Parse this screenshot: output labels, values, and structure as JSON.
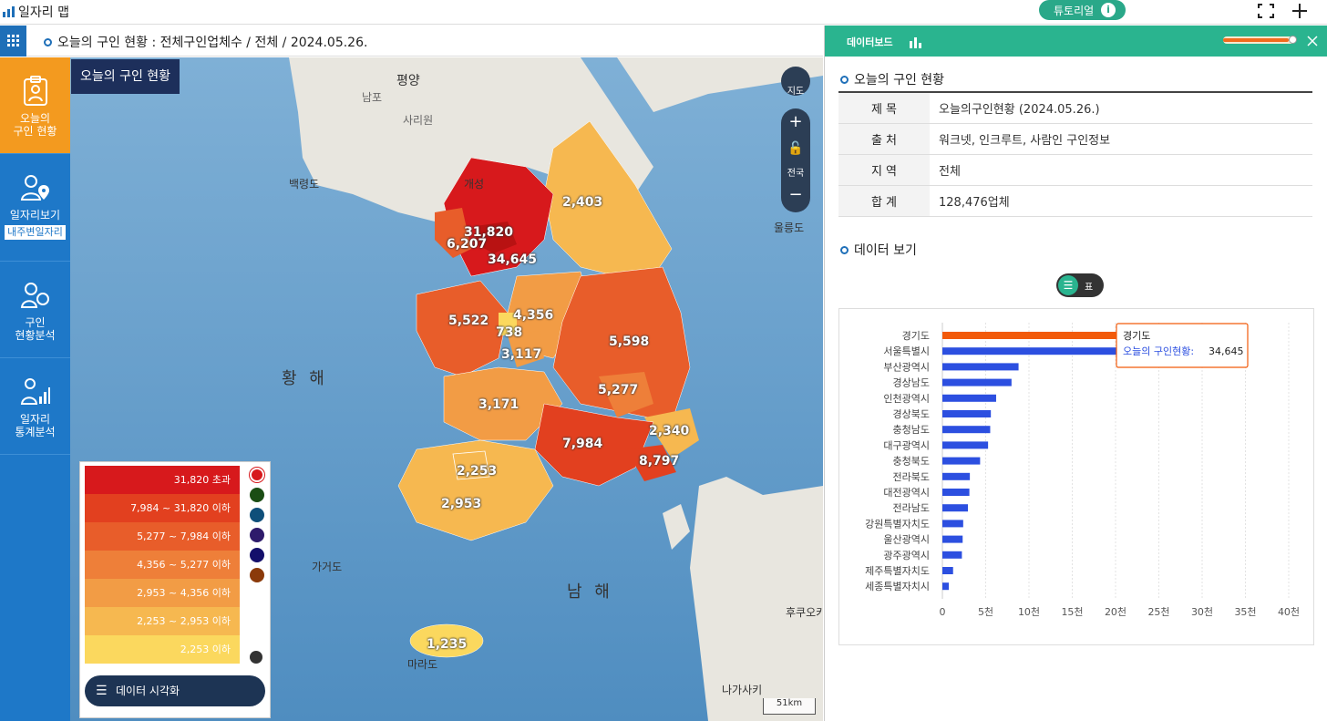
{
  "app": {
    "title": "일자리 맵"
  },
  "topbar": {
    "tutorial_label": "튜토리얼"
  },
  "breadcrumb": {
    "text": "오늘의 구인 현황 : 전체구인업체수 / 전체 / 2024.05.26."
  },
  "sidebar": {
    "items": [
      {
        "line1": "오늘의",
        "line2": "구인 현황",
        "icon": "clipboard-person-icon"
      },
      {
        "line1": "일자리보기",
        "line2": "",
        "sub": "내주변일자리",
        "icon": "person-location-icon"
      },
      {
        "line1": "구인",
        "line2": "현황분석",
        "icon": "person-search-icon"
      },
      {
        "line1": "일자리",
        "line2": "통계분석",
        "icon": "person-chart-icon"
      }
    ]
  },
  "map": {
    "title": "오늘의 구인 현황",
    "globe_label": "지도",
    "nationwide_label": "전국",
    "scale_label": "51km",
    "places": [
      "평양",
      "남포",
      "사리원",
      "개성",
      "백령도",
      "울릉도",
      "가거도",
      "마라도",
      "나가사키",
      "후쿠오카"
    ],
    "seas": [
      "황 해",
      "남 해"
    ],
    "region_values": [
      {
        "region": "경기도",
        "label": "34,645"
      },
      {
        "region": "서울특별시",
        "label": "31,820"
      },
      {
        "region": "인천광역시",
        "label": "6,207"
      },
      {
        "region": "강원특별자치도",
        "label": "2,403"
      },
      {
        "region": "충청남도",
        "label": "5,522"
      },
      {
        "region": "세종특별자치시",
        "label": "738"
      },
      {
        "region": "충청북도",
        "label": "4,356"
      },
      {
        "region": "대전광역시",
        "label": "3,117"
      },
      {
        "region": "경상북도",
        "label": "5,598"
      },
      {
        "region": "대구광역시",
        "label": "5,277"
      },
      {
        "region": "전라북도",
        "label": "3,171"
      },
      {
        "region": "울산광역시",
        "label": "2,340"
      },
      {
        "region": "경상남도",
        "label": "7,984"
      },
      {
        "region": "부산광역시",
        "label": "8,797"
      },
      {
        "region": "광주광역시",
        "label": "2,253"
      },
      {
        "region": "전라남도",
        "label": "2,953"
      },
      {
        "region": "제주특별자치도",
        "label": "1,235"
      }
    ],
    "legend": {
      "ranges": [
        {
          "label": "31,820 초과",
          "color": "#d7191c"
        },
        {
          "label": "7,984 ~ 31,820 이하",
          "color": "#e2401f"
        },
        {
          "label": "5,277 ~ 7,984 이하",
          "color": "#e85d2a"
        },
        {
          "label": "4,356 ~ 5,277 이하",
          "color": "#ee7f39"
        },
        {
          "label": "2,953 ~ 4,356 이하",
          "color": "#f29c45"
        },
        {
          "label": "2,253 ~ 2,953 이하",
          "color": "#f6b850"
        },
        {
          "label": "2,253 이하",
          "color": "#fbd85e"
        }
      ],
      "palette_colors": [
        "#d7191c",
        "#1b4d14",
        "#0f4f7a",
        "#2e1b6b",
        "#140f6b",
        "#8b3a0a"
      ],
      "button_label": "데이터 시각화"
    }
  },
  "panel": {
    "tab_label": "데이터보드",
    "section1_title": "오늘의 구인 현황",
    "info": [
      {
        "key": "제 목",
        "value": "오늘의구인현황 (2024.05.26.)"
      },
      {
        "key": "출 처",
        "value": "워크넷, 인크루트, 사람인 구인정보"
      },
      {
        "key": "지 역",
        "value": "전체"
      },
      {
        "key": "합 계",
        "value": "128,476업체"
      }
    ],
    "section2_title": "데이터 보기",
    "toggle_label": "표",
    "tooltip": {
      "title": "경기도",
      "series": "오늘의 구인현황",
      "value": "34,645"
    }
  },
  "chart_data": {
    "type": "bar",
    "orientation": "horizontal",
    "categories": [
      "경기도",
      "서울특별시",
      "부산광역시",
      "경상남도",
      "인천광역시",
      "경상북도",
      "충청남도",
      "대구광역시",
      "충청북도",
      "전라북도",
      "대전광역시",
      "전라남도",
      "강원특별자치도",
      "울산광역시",
      "광주광역시",
      "제주특별자치도",
      "세종특별자치시"
    ],
    "values": [
      34645,
      31820,
      8797,
      7984,
      6207,
      5598,
      5522,
      5277,
      4356,
      3171,
      3117,
      2953,
      2403,
      2340,
      2253,
      1235,
      738
    ],
    "xticks": [
      "0",
      "5천",
      "10천",
      "15천",
      "20천",
      "25천",
      "30천",
      "35천",
      "40천"
    ],
    "xlim": [
      0,
      40000
    ],
    "colors": {
      "bar": "#2c4fe0",
      "highlight": "#f25a0a"
    },
    "highlighted": "경기도"
  }
}
